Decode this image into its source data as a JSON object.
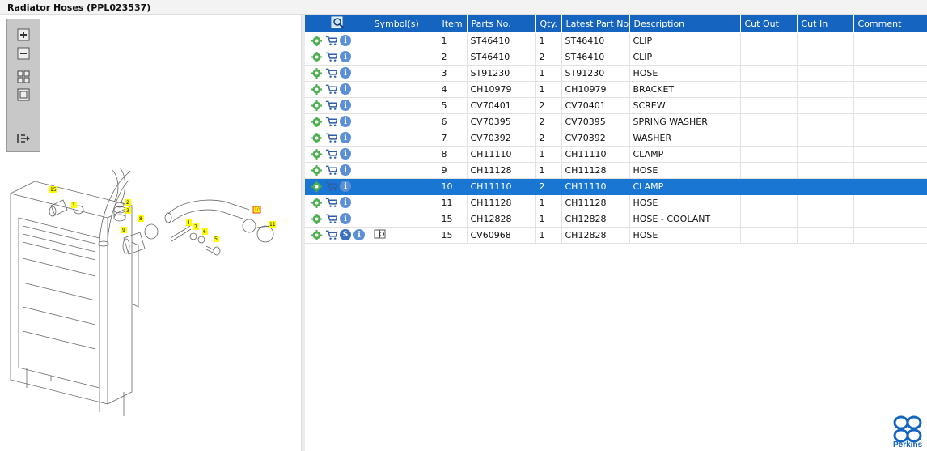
{
  "window": {
    "title": "Radiator Hoses (PPL023537)"
  },
  "toolbox": {
    "tools": [
      "zoom-in-icon",
      "zoom-out-icon",
      "fit-icon",
      "frame-icon",
      "export-icon"
    ]
  },
  "diagram": {
    "callouts": [
      "15",
      "1",
      "2",
      "3",
      "9",
      "8",
      "4",
      "7",
      "6",
      "5",
      "10",
      "11"
    ]
  },
  "table": {
    "columns": [
      "",
      "Symbol(s)",
      "Item",
      "Parts No.",
      "Qty.",
      "Latest Part No.",
      "Description",
      "Cut Out",
      "Cut In",
      "Comment"
    ],
    "rows": [
      {
        "item": "1",
        "part": "ST46410",
        "qty": "1",
        "latest": "ST46410",
        "desc": "CLIP"
      },
      {
        "item": "2",
        "part": "ST46410",
        "qty": "2",
        "latest": "ST46410",
        "desc": "CLIP"
      },
      {
        "item": "3",
        "part": "ST91230",
        "qty": "1",
        "latest": "ST91230",
        "desc": "HOSE"
      },
      {
        "item": "4",
        "part": "CH10979",
        "qty": "1",
        "latest": "CH10979",
        "desc": "BRACKET"
      },
      {
        "item": "5",
        "part": "CV70401",
        "qty": "2",
        "latest": "CV70401",
        "desc": "SCREW"
      },
      {
        "item": "6",
        "part": "CV70395",
        "qty": "2",
        "latest": "CV70395",
        "desc": "SPRING WASHER"
      },
      {
        "item": "7",
        "part": "CV70392",
        "qty": "2",
        "latest": "CV70392",
        "desc": "WASHER"
      },
      {
        "item": "8",
        "part": "CH11110",
        "qty": "1",
        "latest": "CH11110",
        "desc": "CLAMP"
      },
      {
        "item": "9",
        "part": "CH11128",
        "qty": "1",
        "latest": "CH11128",
        "desc": "HOSE"
      },
      {
        "item": "10",
        "part": "CH11110",
        "qty": "2",
        "latest": "CH11110",
        "desc": "CLAMP",
        "selected": true
      },
      {
        "item": "11",
        "part": "CH11128",
        "qty": "1",
        "latest": "CH11128",
        "desc": "HOSE"
      },
      {
        "item": "15",
        "part": "CH12828",
        "qty": "1",
        "latest": "CH12828",
        "desc": "HOSE - COOLANT"
      },
      {
        "item": "15",
        "part": "CV60968",
        "qty": "1",
        "latest": "CH12828",
        "desc": "HOSE",
        "extra": true
      }
    ]
  },
  "brand": {
    "name": "Perkins",
    "color": "#1565c0"
  },
  "colors": {
    "header": "#1565c0",
    "selected": "#1976d2",
    "callout": "#ffff00"
  }
}
